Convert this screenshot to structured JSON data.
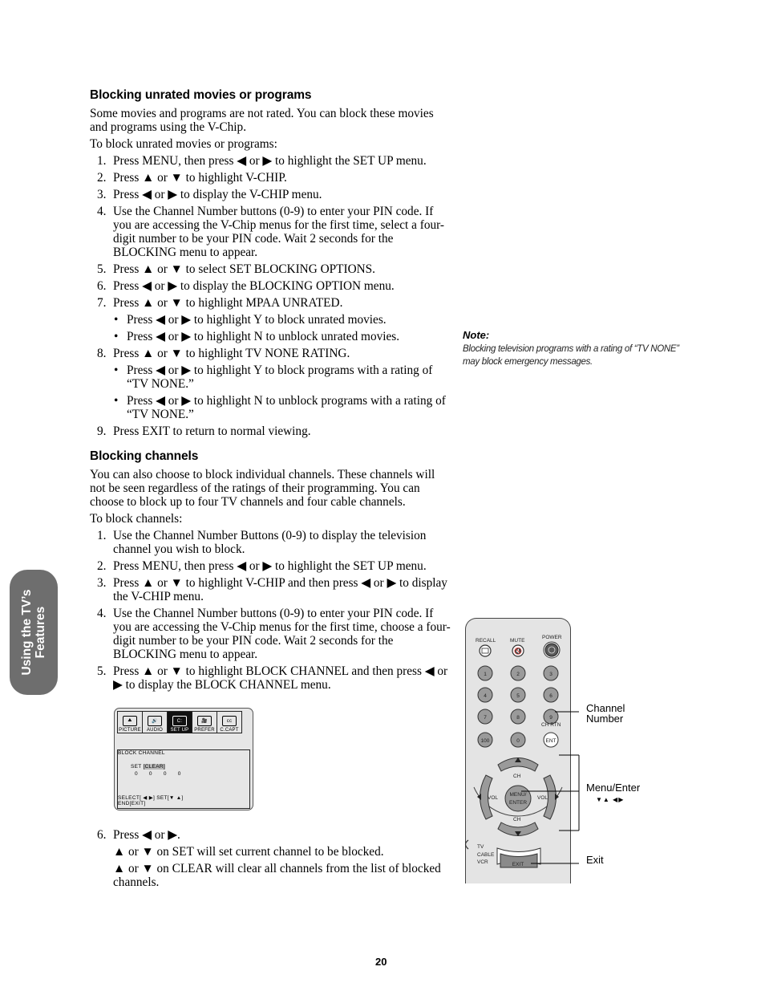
{
  "side_tab": {
    "line1": "Using the TV’s",
    "line2": "Features"
  },
  "section1": {
    "heading": "Blocking unrated movies or programs",
    "intro": "Some movies and programs are not rated. You can block these movies and programs using the V-Chip.",
    "lead": "To block unrated movies or programs:",
    "steps": [
      {
        "num": "1.",
        "text": "Press MENU, then press ◀ or ▶ to highlight the SET UP menu."
      },
      {
        "num": "2.",
        "text": "Press ▲ or ▼ to highlight V-CHIP."
      },
      {
        "num": "3.",
        "text": "Press ◀ or ▶ to display the V-CHIP menu."
      },
      {
        "num": "4.",
        "text": "Use the Channel Number buttons (0-9) to enter your PIN code. If you are accessing the V-Chip menus for the first time, select a four-digit number to be your PIN code. Wait 2 seconds for the BLOCKING menu to appear."
      },
      {
        "num": "5.",
        "text": "Press ▲ or ▼ to select SET BLOCKING OPTIONS."
      },
      {
        "num": "6.",
        "text": "Press ◀ or ▶ to display the BLOCKING OPTION menu."
      },
      {
        "num": "7.",
        "text": "Press ▲ or ▼ to highlight MPAA UNRATED.",
        "bullets": [
          "Press ◀ or ▶ to highlight Y to block unrated movies.",
          "Press ◀ or ▶ to highlight N to unblock unrated movies."
        ]
      },
      {
        "num": "8.",
        "text": "Press ▲ or ▼ to highlight TV NONE RATING.",
        "bullets": [
          "Press ◀ or ▶ to highlight Y to block programs with a rating of “TV NONE.”",
          "Press ◀ or ▶ to highlight N to unblock programs with a rating of “TV NONE.”"
        ]
      },
      {
        "num": "9.",
        "text": "Press EXIT to return to normal viewing."
      }
    ]
  },
  "section2": {
    "heading": "Blocking channels",
    "intro": "You can also choose to block individual channels. These channels will not be seen regardless of the ratings of their programming. You can choose to block up to four TV channels and four cable channels.",
    "lead": "To block channels:",
    "steps": [
      {
        "num": "1.",
        "text": "Use the Channel Number Buttons (0-9) to display the television channel you wish to block."
      },
      {
        "num": "2.",
        "text": "Press MENU, then press ◀ or ▶ to highlight the SET UP menu."
      },
      {
        "num": "3.",
        "text": "Press ▲ or ▼ to highlight V-CHIP and then press ◀ or ▶ to display the V-CHIP menu."
      },
      {
        "num": "4.",
        "text": "Use the Channel Number buttons (0-9) to enter your PIN code. If you are accessing the V-Chip menus for the first time, choose a four-digit number to be your PIN code. Wait 2 seconds for the BLOCKING menu to appear."
      },
      {
        "num": "5.",
        "text": "Press ▲ or ▼ to highlight BLOCK CHANNEL and then press ◀ or ▶ to display the BLOCK CHANNEL menu."
      }
    ],
    "step6": {
      "num": "6.",
      "text": "Press ◀ or ▶.",
      "paras": [
        "▲ or ▼ on SET will set current channel to be blocked.",
        "▲ or ▼ on CLEAR will clear all channels from the list of blocked channels."
      ]
    }
  },
  "osd": {
    "tabs": [
      {
        "label": "PICTURE",
        "icon": "picture-icon",
        "glyph": "⛰",
        "active": false
      },
      {
        "label": "AUDIO",
        "icon": "speaker-icon",
        "glyph": "🔊",
        "active": false
      },
      {
        "label": "SET UP",
        "icon": "tv-setup-icon",
        "glyph": "C:",
        "active": true
      },
      {
        "label": "PREFER",
        "icon": "camera-icon",
        "glyph": "🎥",
        "active": false
      },
      {
        "label": "C.CAPT",
        "icon": "cc-icon",
        "glyph": "cc",
        "active": false
      }
    ],
    "title": "BLOCK CHANNEL",
    "set_label": "SET",
    "clear_label": "[CLEAR]",
    "channels": [
      "0",
      "0",
      "0",
      "0"
    ],
    "select_hint": "SELECT[ ◀ ▶]  SET[▼ ▲]",
    "end_hint": "END[EXIT]"
  },
  "note": {
    "title": "Note:",
    "text": "Blocking television programs with a rating of “TV NONE” may block emergency messages."
  },
  "remote": {
    "labels": {
      "recall": "RECALL",
      "mute": "MUTE",
      "power": "POWER",
      "ch_rtn": "CH RTN",
      "ch": "CH",
      "vol": "VOL",
      "menu_enter_1": "MENU/",
      "menu_enter_2": "ENTER",
      "exit": "EXIT",
      "tv": "TV",
      "cable": "CABLE",
      "vcr": "VCR"
    },
    "number_keys": [
      "1",
      "2",
      "3",
      "4",
      "5",
      "6",
      "7",
      "8",
      "9",
      "100",
      "0",
      "ENT"
    ],
    "callouts": {
      "channel_number_1": "Channel",
      "channel_number_2": "Number",
      "menu_enter": "Menu/Enter",
      "menu_enter_arrows": "▼▲ ◀▶",
      "exit": "Exit"
    }
  },
  "page_number": "20"
}
